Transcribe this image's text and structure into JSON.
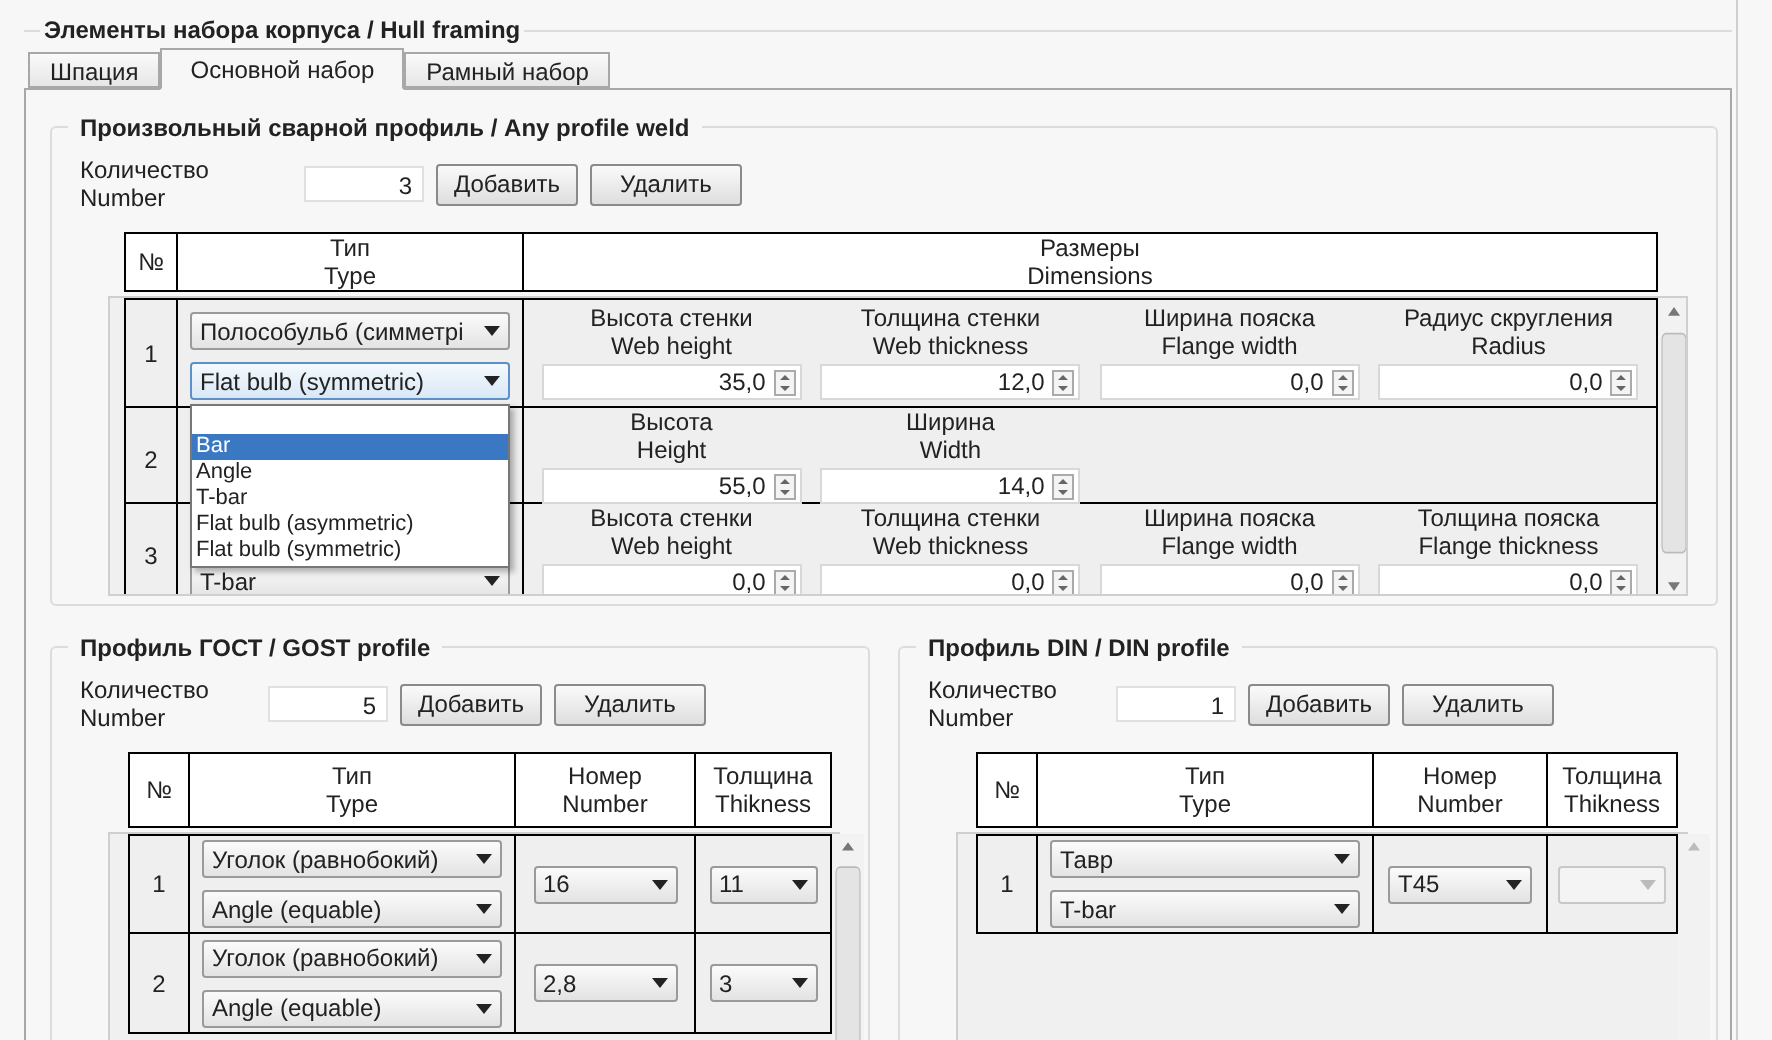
{
  "title": "Элементы набора корпуса / Hull framing",
  "tabs": [
    {
      "label": "Шпация",
      "selected": false
    },
    {
      "label": "Основной набор",
      "selected": true
    },
    {
      "label": "Рамный набор",
      "selected": false
    }
  ],
  "weld": {
    "legend": "Произвольный сварной профиль / Any profile weld",
    "count_label_ru": "Количество",
    "count_label_en": "Number",
    "count": "3",
    "add": "Добавить",
    "remove": "Удалить",
    "columns": [
      {
        "ru": "№"
      },
      {
        "ru": "Тип",
        "en": "Type"
      },
      {
        "ru": "Размеры",
        "en": "Dimensions"
      }
    ],
    "rows": [
      {
        "no": "1",
        "type_ru": "Полособульб (симметрі",
        "type_en": "Flat bulb (symmetric)",
        "dropdown_open": true,
        "dims": [
          {
            "ru": "Высота стенки",
            "en": "Web height",
            "value": "35,0"
          },
          {
            "ru": "Толщина стенки",
            "en": "Web thickness",
            "value": "12,0"
          },
          {
            "ru": "Ширина пояска",
            "en": "Flange width",
            "value": "0,0"
          },
          {
            "ru": "Радиус скругления",
            "en": "Radius",
            "value": "0,0"
          }
        ]
      },
      {
        "no": "2",
        "dims": [
          {
            "ru": "Высота",
            "en": "Height",
            "value": "55,0"
          },
          {
            "ru": "Ширина",
            "en": "Width",
            "value": "14,0"
          }
        ]
      },
      {
        "no": "3",
        "type_en": "T-bar",
        "dims": [
          {
            "ru": "Высота стенки",
            "en": "Web height",
            "value": "0,0"
          },
          {
            "ru": "Толщина стенки",
            "en": "Web thickness",
            "value": "0,0"
          },
          {
            "ru": "Ширина пояска",
            "en": "Flange width",
            "value": "0,0"
          },
          {
            "ru": "Толщина пояска",
            "en": "Flange thickness",
            "value": "0,0"
          }
        ]
      }
    ],
    "dropdown_items": [
      {
        "label": "Bar",
        "selected": true
      },
      {
        "label": "Angle",
        "selected": false
      },
      {
        "label": "T-bar",
        "selected": false
      },
      {
        "label": "Flat bulb (asymmetric)",
        "selected": false
      },
      {
        "label": "Flat bulb (symmetric)",
        "selected": false
      }
    ]
  },
  "gost": {
    "legend": "Профиль ГОСТ / GOST profile",
    "count_label_ru": "Количество",
    "count_label_en": "Number",
    "count": "5",
    "add": "Добавить",
    "remove": "Удалить",
    "columns": [
      {
        "ru": "№"
      },
      {
        "ru": "Тип",
        "en": "Type"
      },
      {
        "ru": "Номер",
        "en": "Number"
      },
      {
        "ru": "Толщина",
        "en": "Thikness"
      }
    ],
    "rows": [
      {
        "no": "1",
        "type_ru": "Уголок (равнобокий)",
        "type_en": "Angle (equable)",
        "number": "16",
        "thickness": "11",
        "thickness_disabled": false
      },
      {
        "no": "2",
        "type_ru": "Уголок (равнобокий)",
        "type_en": "Angle (equable)",
        "number": "2,8",
        "thickness": "3",
        "thickness_disabled": false
      }
    ]
  },
  "din": {
    "legend": "Профиль DIN / DIN profile",
    "count_label_ru": "Количество",
    "count_label_en": "Number",
    "count": "1",
    "add": "Добавить",
    "remove": "Удалить",
    "columns": [
      {
        "ru": "№"
      },
      {
        "ru": "Тип",
        "en": "Type"
      },
      {
        "ru": "Номер",
        "en": "Number"
      },
      {
        "ru": "Толщина",
        "en": "Thikness"
      }
    ],
    "rows": [
      {
        "no": "1",
        "type_ru": "Тавр",
        "type_en": "T-bar",
        "number": "T45",
        "thickness_disabled": true
      }
    ]
  }
}
